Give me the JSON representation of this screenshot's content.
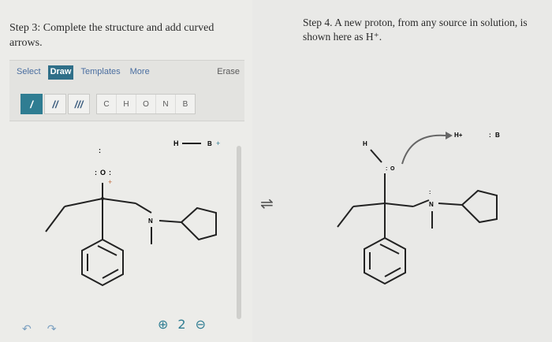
{
  "step3": {
    "text": "Step 3: Complete the structure and add curved arrows."
  },
  "toolbar": {
    "tabs": [
      "Select",
      "Draw",
      "Templates",
      "More"
    ],
    "erase": "Erase",
    "bond_buttons": [
      "/",
      "//",
      "///"
    ],
    "atom_buttons": [
      "C",
      "H",
      "O",
      "N",
      "B"
    ]
  },
  "left_molecule": {
    "h_label": "H",
    "b_label": "B",
    "plus": "+",
    "o_label": "O",
    "n_label": "N",
    "lone_pair_dots": ":",
    "charge": "+"
  },
  "controls": {
    "undo": "↶",
    "redo": "↷",
    "zoom_in": "⊕",
    "zoom_reset": "2",
    "zoom_out": "⊖"
  },
  "equilibrium_symbol": "⇌",
  "step4": {
    "text": "Step 4. A new proton, from any source in solution, is shown here as H⁺."
  },
  "right_molecule": {
    "h_label": "H",
    "h_plus": "H+",
    "b_label": "B",
    "o_label": "O",
    "n_label": "N",
    "lone_pair": ":"
  },
  "colors": {
    "accent": "#2f6f88",
    "link": "#4a6ea0",
    "bond": "#222222"
  }
}
